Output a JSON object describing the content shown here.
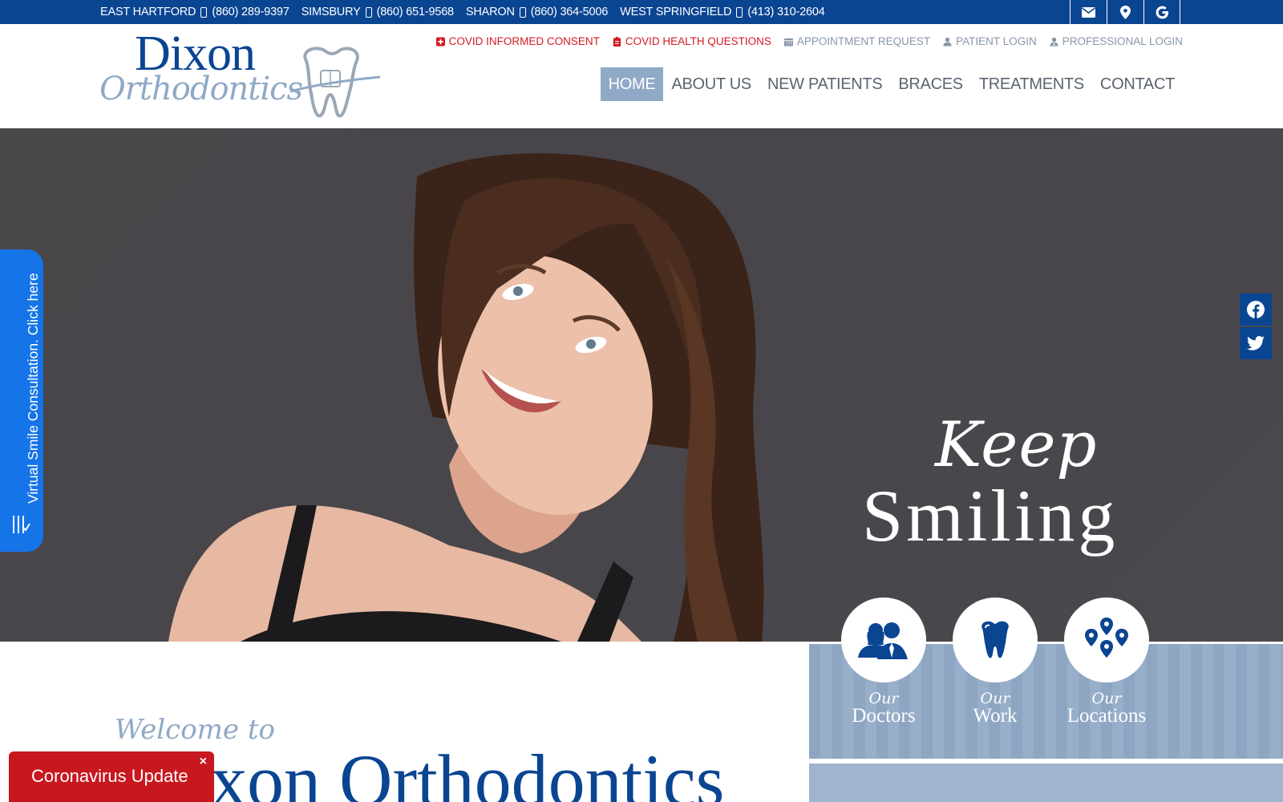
{
  "topbar": {
    "locations": [
      {
        "name": "EAST HARTFORD",
        "phone": "(860) 289-9397"
      },
      {
        "name": "SIMSBURY",
        "phone": "(860) 651-9568"
      },
      {
        "name": "SHARON",
        "phone": "(860) 364-5006"
      },
      {
        "name": "WEST SPRINGFIELD",
        "phone": "(413) 310-2604"
      }
    ],
    "icons": [
      "envelope-icon",
      "map-pin-icon",
      "google-icon"
    ]
  },
  "logo": {
    "line1": "Dixon",
    "line2": "Orthodontics"
  },
  "utility_links": [
    {
      "label": "COVID INFORMED CONSENT",
      "icon": "plus-square-icon",
      "color": "#d21a22"
    },
    {
      "label": "COVID HEALTH QUESTIONS",
      "icon": "clipboard-icon",
      "color": "#d21a22"
    },
    {
      "label": "APPOINTMENT REQUEST",
      "icon": "calendar-icon",
      "color": "#8796a8"
    },
    {
      "label": "PATIENT LOGIN",
      "icon": "user-icon",
      "color": "#8796a8"
    },
    {
      "label": "PROFESSIONAL LOGIN",
      "icon": "user-tie-icon",
      "color": "#8796a8"
    }
  ],
  "nav": {
    "items": [
      "HOME",
      "ABOUT US",
      "NEW PATIENTS",
      "BRACES",
      "TREATMENTS",
      "CONTACT"
    ],
    "active": "HOME"
  },
  "hero": {
    "line1": "Keep",
    "line2": "Smiling"
  },
  "side_tab": {
    "label": "Virtual Smile Consultation. Click here"
  },
  "social": [
    "facebook-icon",
    "twitter-icon"
  ],
  "features": [
    {
      "our": "Our",
      "name": "Doctors",
      "icon": "people-icon"
    },
    {
      "our": "Our",
      "name": "Work",
      "icon": "tooth-icon"
    },
    {
      "our": "Our",
      "name": "Locations",
      "icon": "map-markers-icon"
    }
  ],
  "welcome": {
    "pre": "Welcome to",
    "title": "Dixon Orthodontics"
  },
  "covid_popup": {
    "label": "Coronavirus Update",
    "close": "×"
  },
  "colors": {
    "brand_blue": "#0a4592",
    "light_blue": "#8fa9c6",
    "alert_red": "#c8181f",
    "tab_blue": "#1574e8"
  }
}
